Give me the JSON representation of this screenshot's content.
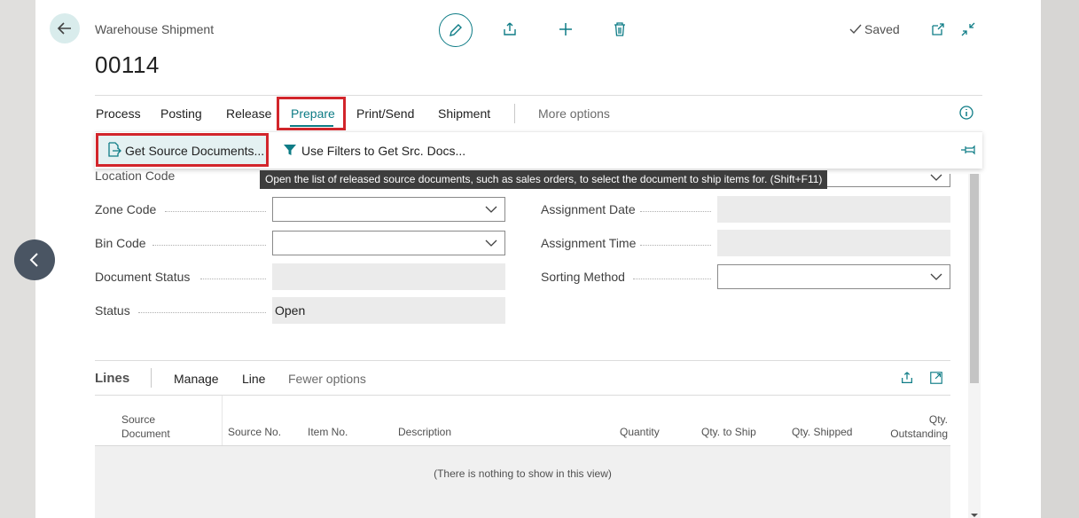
{
  "header": {
    "caption": "Warehouse Shipment",
    "document_no": "00114",
    "saved_label": "Saved"
  },
  "tabs": [
    {
      "label": "Process"
    },
    {
      "label": "Posting"
    },
    {
      "label": "Release"
    },
    {
      "label": "Prepare"
    },
    {
      "label": "Print/Send"
    },
    {
      "label": "Shipment"
    },
    {
      "label": "More options"
    }
  ],
  "actions": {
    "get_source": "Get Source Documents...",
    "use_filters": "Use Filters to Get Src. Docs..."
  },
  "tooltip": "Open the list of released source documents, such as sales orders, to select the document to ship items for.  (Shift+F11)",
  "fields_left": [
    {
      "label": "Location Code"
    },
    {
      "label": "Zone Code",
      "value": ""
    },
    {
      "label": "Bin Code",
      "value": ""
    },
    {
      "label": "Document Status",
      "value": ""
    },
    {
      "label": "Status",
      "value": "Open"
    }
  ],
  "fields_right": [
    {
      "label": "Assignment Date",
      "value": ""
    },
    {
      "label": "Assignment Time",
      "value": ""
    },
    {
      "label": "Sorting Method",
      "value": ""
    }
  ],
  "lines": {
    "title": "Lines",
    "tabs": [
      "Manage",
      "Line",
      "Fewer options"
    ],
    "columns": [
      {
        "line1": "Source",
        "line2": "Document"
      },
      {
        "line1": "",
        "line2": "Source No."
      },
      {
        "line1": "",
        "line2": "Item No."
      },
      {
        "line1": "",
        "line2": "Description"
      },
      {
        "line1": "",
        "line2": "Quantity"
      },
      {
        "line1": "",
        "line2": "Qty. to Ship"
      },
      {
        "line1": "",
        "line2": "Qty. Shipped"
      },
      {
        "line1": "Qty.",
        "line2": "Outstanding"
      }
    ],
    "empty_message": "(There is nothing to show in this view)"
  },
  "colors": {
    "accent": "#0e7c86",
    "highlight_red": "#d2252b",
    "nav_circle": "#4a5563"
  },
  "icons": [
    "back-arrow-icon",
    "pencil-icon",
    "share-icon",
    "plus-icon",
    "trash-icon",
    "checkmark-icon",
    "open-new-window-icon",
    "collapse-icon",
    "info-icon",
    "get-documents-icon",
    "filter-icon",
    "pin-icon",
    "chevron-left-icon",
    "chevron-down-icon",
    "expand-icon"
  ]
}
